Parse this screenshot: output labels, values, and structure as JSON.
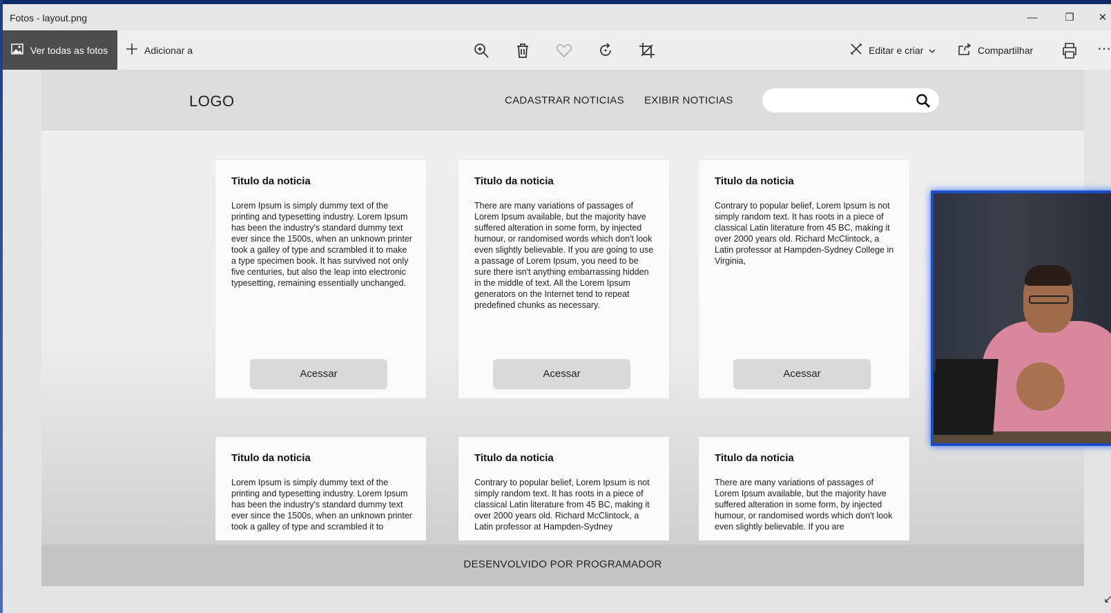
{
  "window": {
    "title": "Fotos - layout.png",
    "minimize_icon": "minimize-icon",
    "maximize_icon": "restore-icon",
    "close_icon": "close-icon"
  },
  "toolbar": {
    "view_all_label": "Ver todas as fotos",
    "add_to_label": "Adicionar a",
    "zoom_icon": "zoom-in-icon",
    "delete_icon": "trash-icon",
    "favorite_icon": "heart-icon",
    "rotate_icon": "rotate-icon",
    "crop_icon": "crop-icon",
    "edit_label": "Editar e criar",
    "share_label": "Compartilhar",
    "print_icon": "print-icon",
    "more_icon": "more-icon"
  },
  "mockup": {
    "logo": "LOGO",
    "nav": [
      "CADASTRAR NOTICIAS",
      "EXIBIR NOTICIAS"
    ],
    "search_placeholder": "",
    "cards_row1": [
      {
        "title": "Titulo da noticia",
        "body": "Lorem Ipsum is simply dummy text of the printing and typesetting industry. Lorem Ipsum has been the industry's standard dummy text ever since the 1500s, when an unknown printer took a galley of type and scrambled it to make a type specimen book. It has survived not only five centuries, but also the leap into electronic typesetting, remaining essentially unchanged.",
        "button": "Acessar"
      },
      {
        "title": "Titulo da noticia",
        "body": "There are many variations of passages of Lorem Ipsum available, but the majority have suffered alteration in some form, by injected humour, or randomised words which don't look even slightly believable. If you are going to use a passage of Lorem Ipsum, you need to be sure there isn't anything embarrassing hidden in the middle of text. All the Lorem Ipsum generators on the Internet tend to repeat predefined chunks as necessary.",
        "button": "Acessar"
      },
      {
        "title": "Titulo da noticia",
        "body": "Contrary to popular belief, Lorem Ipsum is not simply random text. It has roots in a piece of classical Latin literature from 45 BC, making it over 2000 years old. Richard McClintock, a Latin professor at Hampden-Sydney College in Virginia,",
        "button": "Acessar"
      }
    ],
    "cards_row2": [
      {
        "title": "Titulo da noticia",
        "body": "Lorem Ipsum is simply dummy text of the printing and typesetting industry. Lorem Ipsum has been the industry's standard dummy text ever since the 1500s, when an unknown printer took a galley of type and scrambled it to"
      },
      {
        "title": "Titulo da noticia",
        "body": "Contrary to popular belief, Lorem Ipsum is not simply random text. It has roots in a piece of classical Latin literature from 45 BC, making it over 2000 years old. Richard McClintock, a Latin professor at Hampden-Sydney"
      },
      {
        "title": "Titulo da noticia",
        "body": "There are many variations of passages of Lorem Ipsum available, but the majority have suffered alteration in some form, by injected humour, or randomised words which don't look even slightly believable. If you are"
      }
    ],
    "footer": "DESENVOLVIDO POR PROGRAMADOR"
  },
  "colors": {
    "toolbar_active_bg": "#4d4d4d",
    "webcam_border": "#1d4cc9"
  }
}
